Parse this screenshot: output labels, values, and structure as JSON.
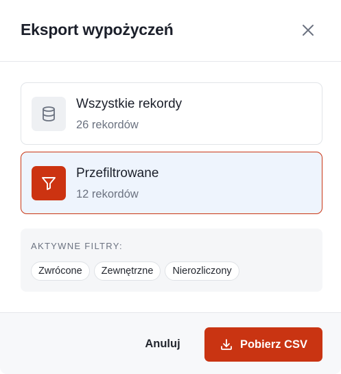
{
  "dialog": {
    "title": "Eksport wypożyczeń"
  },
  "options": [
    {
      "label": "Wszystkie rekordy",
      "count": "26 rekordów",
      "icon": "database-icon",
      "selected": false
    },
    {
      "label": "Przefiltrowane",
      "count": "12 rekordów",
      "icon": "filter-icon",
      "selected": true
    }
  ],
  "filters": {
    "heading": "AKTYWNE FILTRY:",
    "chips": [
      "Zwrócone",
      "Zewnętrzne",
      "Nierozliczony"
    ]
  },
  "footer": {
    "cancel_label": "Anuluj",
    "download_label": "Pobierz CSV",
    "download_icon": "download-icon"
  },
  "colors": {
    "accent": "#c93412",
    "selected_bg": "#eef4fd",
    "muted_text": "#6b7280"
  }
}
